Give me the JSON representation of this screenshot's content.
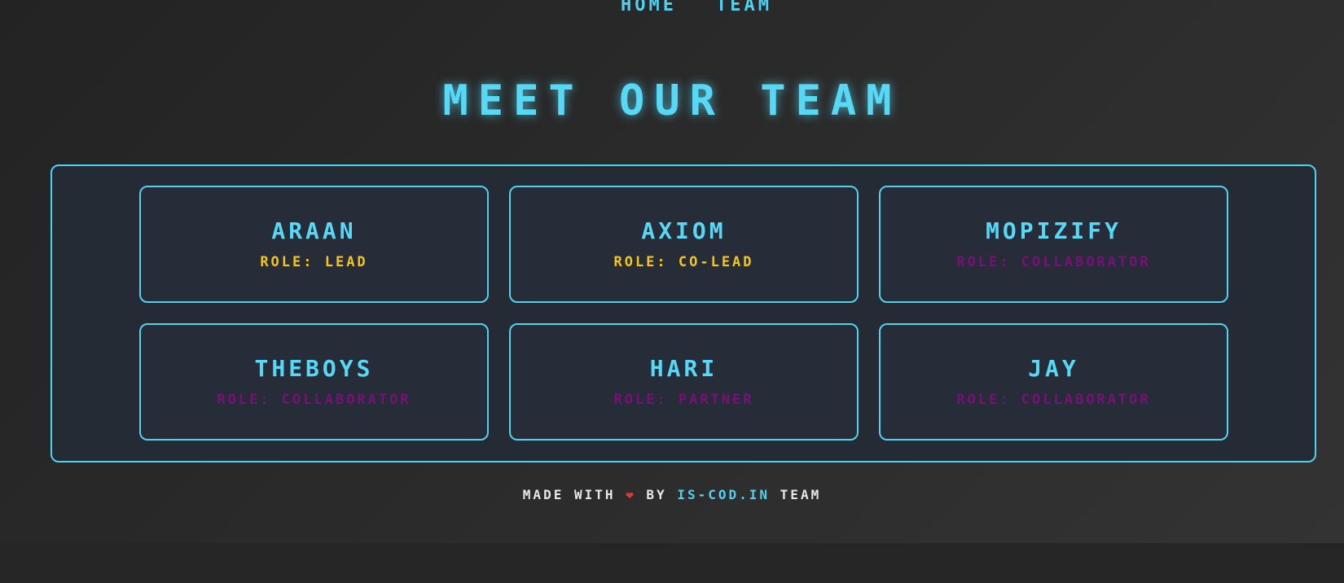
{
  "nav": {
    "items": [
      {
        "label": "HOME"
      },
      {
        "label": "TEAM"
      }
    ]
  },
  "title": "MEET OUR TEAM",
  "team": [
    {
      "name": "ARAAN",
      "role": "ROLE: LEAD",
      "role_color": "#f5c518"
    },
    {
      "name": "AXIOM",
      "role": "ROLE: CO-LEAD",
      "role_color": "#f5c518"
    },
    {
      "name": "MOPIZIFY",
      "role": "ROLE: COLLABORATOR",
      "role_color": "#7a0f7a"
    },
    {
      "name": "THEBOYS",
      "role": "ROLE: COLLABORATOR",
      "role_color": "#7a0f7a"
    },
    {
      "name": "HARI",
      "role": "ROLE: PARTNER",
      "role_color": "#7a0f7a"
    },
    {
      "name": "JAY",
      "role": "ROLE: COLLABORATOR",
      "role_color": "#7a0f7a"
    }
  ],
  "footer": {
    "made_with": "MADE WITH",
    "heart": "❤",
    "by": "BY",
    "link_text": "IS-COD.IN",
    "suffix": "TEAM"
  },
  "colors": {
    "accent": "#4fd1f0",
    "lead_role": "#f5c518",
    "other_role": "#7a0f7a"
  }
}
